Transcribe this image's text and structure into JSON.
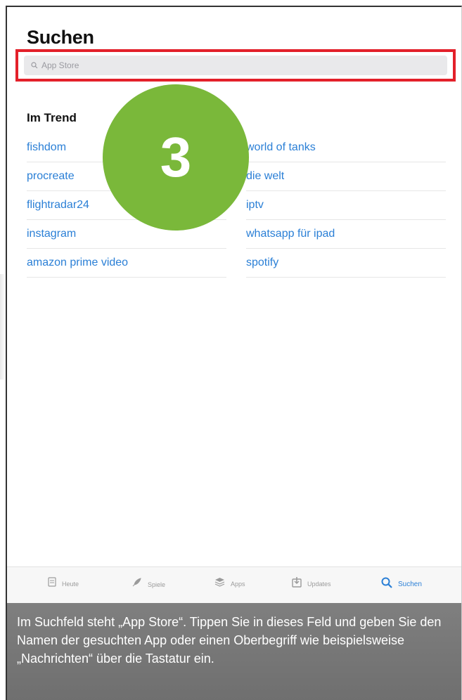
{
  "page": {
    "title": "Suchen"
  },
  "search": {
    "placeholder": "App Store"
  },
  "trending": {
    "title": "Im Trend",
    "left": [
      "fishdom",
      "procreate",
      "flightradar24",
      "instagram",
      "amazon prime video"
    ],
    "right": [
      "world of tanks",
      "die welt",
      "iptv",
      "whatsapp für ipad",
      "spotify"
    ]
  },
  "step_badge": {
    "number": "3",
    "color": "#7ab83a"
  },
  "tabbar": {
    "tabs": [
      {
        "label": "Heute",
        "icon": "today-icon"
      },
      {
        "label": "Spiele",
        "icon": "rocket-icon"
      },
      {
        "label": "Apps",
        "icon": "apps-stack-icon"
      },
      {
        "label": "Updates",
        "icon": "updates-icon"
      },
      {
        "label": "Suchen",
        "icon": "search-icon",
        "active": true
      }
    ]
  },
  "caption": {
    "text": "Im Suchfeld steht „App Store“. Tippen Sie in dieses Feld und geben Sie den Namen der gesuchten App oder einen Oberbegriff wie beispielsweise „Nachrichten“ über die Tastatur ein."
  },
  "colors": {
    "highlight": "#e3202a",
    "link": "#2a7fd6",
    "badge": "#7ab83a"
  }
}
